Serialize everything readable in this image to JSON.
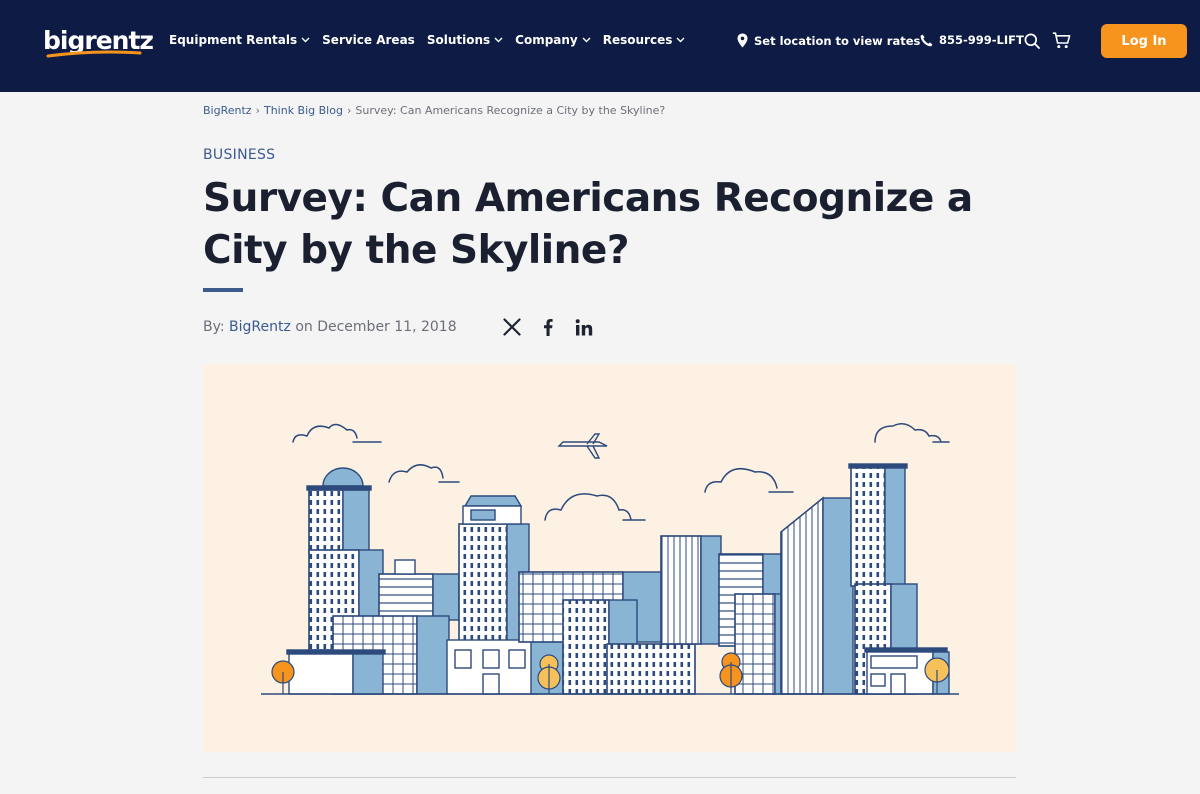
{
  "header": {
    "logo_text": "bigrentz",
    "nav": [
      {
        "label": "Equipment Rentals",
        "dropdown": true
      },
      {
        "label": "Service Areas",
        "dropdown": false
      },
      {
        "label": "Solutions",
        "dropdown": true
      },
      {
        "label": "Company",
        "dropdown": true
      },
      {
        "label": "Resources",
        "dropdown": true
      }
    ],
    "location_text": "Set location to view rates",
    "phone_text": "855-999-LIFT",
    "login_label": "Log In",
    "icons": [
      "map-pin-icon",
      "phone-icon",
      "search-icon",
      "cart-icon",
      "chevron-down-icon"
    ]
  },
  "breadcrumb": {
    "items": [
      "BigRentz",
      "Think Big Blog",
      "Survey: Can Americans Recognize a City by the Skyline?"
    ],
    "separator": "›"
  },
  "article": {
    "category": "BUSINESS",
    "title": "Survey: Can Americans Recognize a City by the Skyline?",
    "byline_prefix": "By:",
    "author": "BigRentz",
    "date_prefix": "on",
    "date": "December 11, 2018",
    "share_icons": [
      "x-icon",
      "facebook-icon",
      "linkedin-icon"
    ]
  },
  "colors": {
    "header_bg": "#0d1b45",
    "accent_orange": "#f7941d",
    "link_blue": "#3b5b8f",
    "hero_bg": "#fdf1e3",
    "building_blue": "#8ab4d4"
  }
}
